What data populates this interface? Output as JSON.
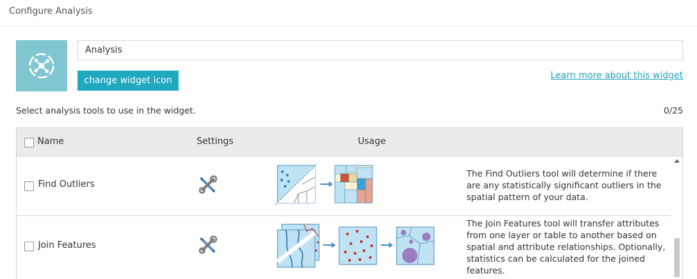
{
  "header": {
    "title": "Configure Analysis"
  },
  "widget": {
    "icon": "analysis-network-icon",
    "name_value": "Analysis",
    "change_icon_label": "change widget icon",
    "learn_more_label": "Learn more about this widget"
  },
  "tools": {
    "instruction": "Select analysis tools to use in the widget.",
    "count": "0/25",
    "columns": {
      "name": "Name",
      "settings": "Settings",
      "usage": "Usage"
    },
    "rows": [
      {
        "name": "Find Outliers",
        "settings_icon": "wrench-screwdriver-icon",
        "usage_icon": "find-outliers-diagram-icon",
        "description": "The Find Outliers tool will determine if there are any statistically significant outliers in the spatial pattern of your data."
      },
      {
        "name": "Join Features",
        "settings_icon": "wrench-screwdriver-icon",
        "usage_icon": "join-features-diagram-icon",
        "description": "The Join Features tool will transfer attributes from one layer or table to another based on spatial and attribute relationships. Optionally, statistics can be calculated for the joined features."
      }
    ]
  },
  "colors": {
    "accent": "#1fa9bf",
    "icon_tile": "#7fc6d1",
    "link": "#1fa3b8",
    "diagram_blue": "#bfe3f3",
    "outlier_red": "#c0392b",
    "join_purple": "#9b7cc2"
  }
}
